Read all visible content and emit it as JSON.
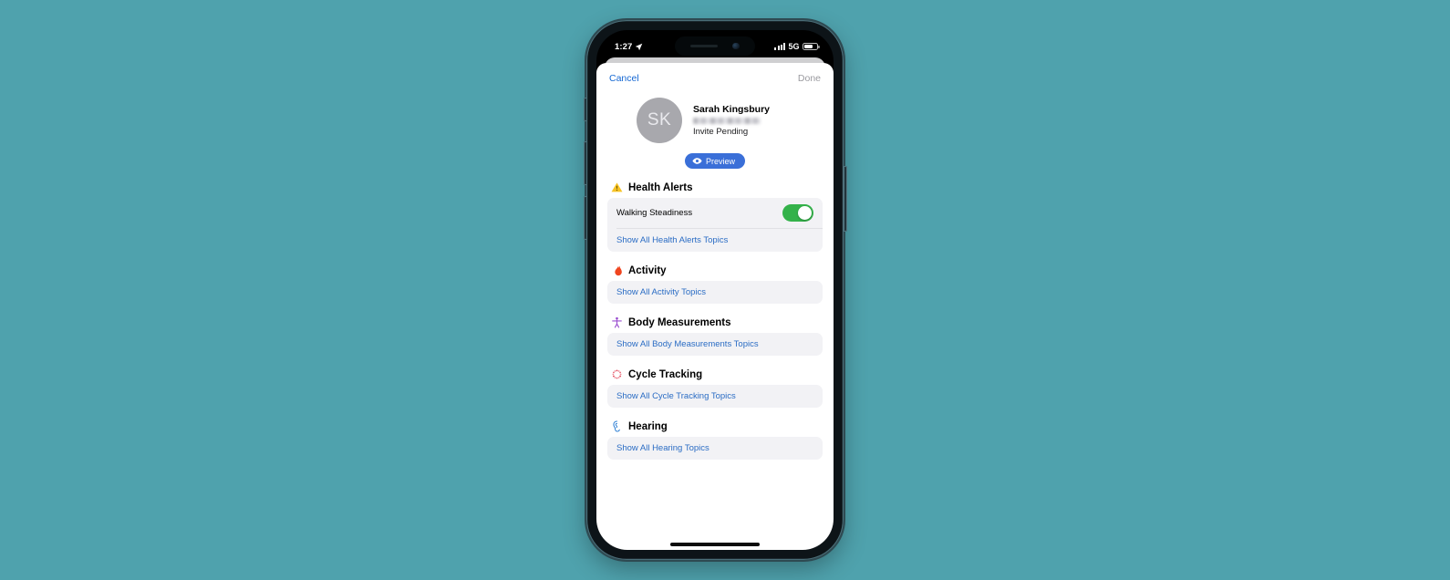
{
  "background_color": "#4FA2AD",
  "status_bar": {
    "time": "1:27",
    "location_icon": "location-arrow-icon",
    "signal_icon": "cellular-signal-icon",
    "network": "5G",
    "battery_icon": "battery-icon"
  },
  "sheet": {
    "cancel_label": "Cancel",
    "done_label": "Done"
  },
  "profile": {
    "initials": "SK",
    "name": "Sarah Kingsbury",
    "email_redacted": "",
    "status": "Invite Pending",
    "preview_label": "Preview",
    "preview_icon": "eye-icon",
    "preview_color": "#3a6fd8"
  },
  "sections": [
    {
      "id": "health-alerts",
      "title": "Health Alerts",
      "icon": "warning-triangle-icon",
      "icon_color": "#f7c325",
      "rows": [
        {
          "label": "Walking Steadiness",
          "toggle": true,
          "toggle_on": true,
          "toggle_color": "#34b24a"
        }
      ],
      "show_all_label": "Show All Health Alerts Topics"
    },
    {
      "id": "activity",
      "title": "Activity",
      "icon": "flame-icon",
      "icon_color": "#f0451f",
      "rows": [],
      "show_all_label": "Show All Activity Topics"
    },
    {
      "id": "body-measurements",
      "title": "Body Measurements",
      "icon": "body-figure-icon",
      "icon_color": "#9b4fd0",
      "rows": [],
      "show_all_label": "Show All Body Measurements Topics"
    },
    {
      "id": "cycle-tracking",
      "title": "Cycle Tracking",
      "icon": "cycle-dots-icon",
      "icon_color": "#e03a4e",
      "rows": [],
      "show_all_label": "Show All Cycle Tracking Topics"
    },
    {
      "id": "hearing",
      "title": "Hearing",
      "icon": "ear-icon",
      "icon_color": "#2d7fd4",
      "rows": [],
      "show_all_label": "Show All Hearing Topics"
    }
  ]
}
